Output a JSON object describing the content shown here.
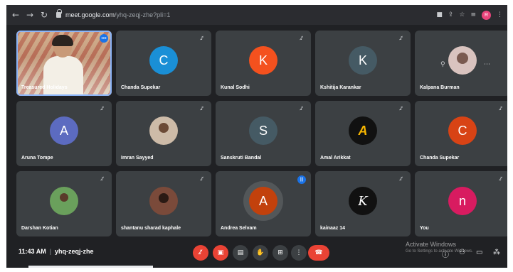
{
  "browser": {
    "url_host": "meet.google.com",
    "url_path": "/yhq-zeqj-zhe?pli=1",
    "nav_icons": [
      "back-arrow-icon",
      "forward-arrow-icon",
      "reload-icon"
    ],
    "profile_initial": "R"
  },
  "participants": [
    {
      "name": "Treasured Holidays",
      "type": "video"
    },
    {
      "name": "Chanda Supekar",
      "type": "initial",
      "initial": "C",
      "color": "#1a8fd6"
    },
    {
      "name": "Kunal Sodhi",
      "type": "initial",
      "initial": "K",
      "color": "#f4511e"
    },
    {
      "name": "Kshitija Karankar",
      "type": "initial",
      "initial": "K",
      "color": "#455a64"
    },
    {
      "name": "Kalpana Burman",
      "type": "photo",
      "photo_color": "#d9c3bf"
    },
    {
      "name": "Aruna Tompe",
      "type": "initial",
      "initial": "A",
      "color": "#5c6bc0"
    },
    {
      "name": "Imran Sayyed",
      "type": "photo",
      "photo_color": "#cdbba8"
    },
    {
      "name": "Sanskruti Bandal",
      "type": "initial",
      "initial": "S",
      "color": "#455a64"
    },
    {
      "name": "Amal Arikkat",
      "type": "logo",
      "logo_text": "A",
      "color": "#111111"
    },
    {
      "name": "Chanda Supekar",
      "type": "initial",
      "initial": "C",
      "color": "#d84315"
    },
    {
      "name": "Darshan Kotian",
      "type": "photo",
      "photo_color": "#6aa05c"
    },
    {
      "name": "shantanu sharad kaphale",
      "type": "photo",
      "photo_color": "#7a4a3a"
    },
    {
      "name": "Andrea Selvam",
      "type": "initial",
      "initial": "A",
      "color": "#c2410c",
      "speaking": true
    },
    {
      "name": "kainaaz 14",
      "type": "logo",
      "logo_text": "K",
      "color": "#111111"
    },
    {
      "name": "You",
      "type": "initial",
      "initial": "n",
      "color": "#d81b60"
    }
  ],
  "meeting": {
    "time": "11:43 AM",
    "code": "yhq-zeqj-zhe"
  },
  "controls": {
    "mic": "mic-off-icon",
    "camera": "camera-off-icon",
    "captions": "captions-icon",
    "raise_hand": "raise-hand-icon",
    "present": "present-screen-icon",
    "more": "more-options-icon",
    "hangup": "hang-up-icon"
  },
  "watermark": {
    "line1": "Activate Windows",
    "line2": "Go to Settings to activate Windows."
  }
}
